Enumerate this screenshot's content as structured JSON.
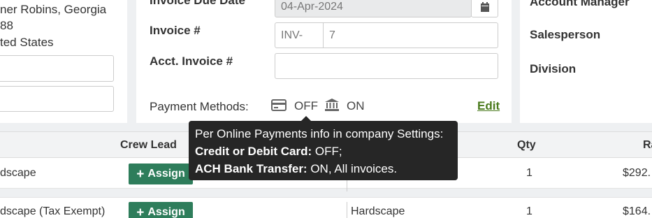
{
  "address": {
    "line1": "ner Robins, Georgia",
    "line2": "88",
    "line3": "ted States"
  },
  "invoice": {
    "due_date_label": "Invoice Due Date",
    "due_date_value": "04-Apr-2024",
    "number_label": "Invoice #",
    "number_prefix": "INV-",
    "number_value": "7",
    "acct_label": "Acct. Invoice #",
    "acct_value": ""
  },
  "payment_methods": {
    "label": "Payment Methods:",
    "card_status": "OFF",
    "bank_status": "ON",
    "edit_label": "Edit",
    "card_icon": "credit-card-icon",
    "bank_icon": "bank-icon"
  },
  "right_panel": {
    "account_manager_label": "Account Manager",
    "salesperson_label": "Salesperson",
    "division_label": "Division"
  },
  "table": {
    "headers": {
      "crew_lead": "Crew Lead",
      "qty": "Qty",
      "rate": "Ra"
    },
    "assign_label": "Assign",
    "rows": [
      {
        "name": "dscape",
        "category": "",
        "qty": "1",
        "rate": "$292."
      },
      {
        "name": "dscape (Tax Exempt)",
        "category": "Hardscape",
        "qty": "1",
        "rate": "$164."
      }
    ]
  },
  "tooltip": {
    "line1": "Per Online Payments info in company Settings:",
    "card_label": "Credit or Debit Card:",
    "card_value": " OFF;",
    "bank_label": "ACH Bank Transfer:",
    "bank_value": " ON, All invoices."
  },
  "colors": {
    "assign_button": "#2e7d5b",
    "edit_link": "#4a7a1c",
    "tooltip_bg": "#262626"
  }
}
